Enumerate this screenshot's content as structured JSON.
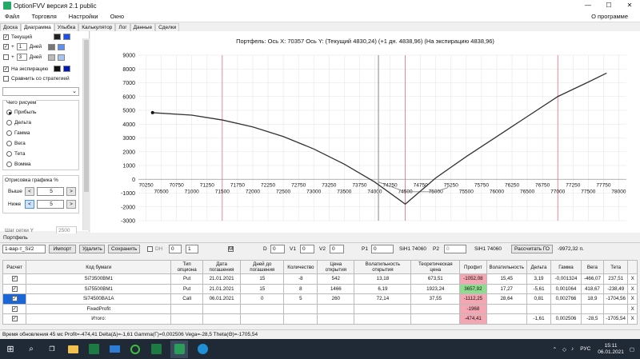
{
  "window": {
    "title": "OptionFVV версия 2.1 public",
    "minimize": "—",
    "maximize": "☐",
    "close": "✕"
  },
  "menu": {
    "file": "Файл",
    "trade": "Торговля",
    "settings": "Настройки",
    "window": "Окно",
    "about": "О программе"
  },
  "tabs": [
    "Доска",
    "Диаграмма",
    "Улыбка",
    "Калькулятор",
    "Лог",
    "Данные",
    "Сделки"
  ],
  "left": {
    "current": "Текущий",
    "plus1": "+",
    "days1_val": "1",
    "days_label": "Дней",
    "plus2": "+",
    "days2_val": "3",
    "on_expiry": "На экспирацию",
    "compare": "Сравнить со стратегией",
    "what_draw": "Чего рисуем",
    "radios": [
      "Прибыль",
      "Дельта",
      "Гамма",
      "Вега",
      "Тета",
      "Вомма"
    ],
    "scale_title": "Отрисовка графика %",
    "higher": "Выше",
    "higher_val": "5",
    "lower": "Ниже",
    "lower_val": "5",
    "step": "Шаг сетки Y",
    "step_val": "2500",
    "arrow_left": "<",
    "arrow_right": ">"
  },
  "colors": {
    "line": "#333333",
    "red": "#e05a6a",
    "grid": "#e6e6e6",
    "accent": "#1a66d6"
  },
  "chart_data": {
    "type": "line",
    "title": "Портфель:  Ось X: 70357 Ось Y:   (Текущий 4830,24)  (+1 дн. 4838,96)  (На экспирацию 4838,96)",
    "x_ticks_top": [
      "70250",
      "70750",
      "71250",
      "71750",
      "72250",
      "72750",
      "73250",
      "73750",
      "74250",
      "74750",
      "75250",
      "75750",
      "76250",
      "76750",
      "77250",
      "77750"
    ],
    "x_ticks_bottom": [
      "70500",
      "71000",
      "71500",
      "72000",
      "72500",
      "73000",
      "73500",
      "74000",
      "74500",
      "75000",
      "75500",
      "76000",
      "76500",
      "77000",
      "77500",
      "78000"
    ],
    "xlim": [
      70125,
      78125
    ],
    "ylim": [
      -3000,
      9000
    ],
    "y_ticks": [
      "9000",
      "8000",
      "7000",
      "6000",
      "5000",
      "4000",
      "3000",
      "2000",
      "1000",
      "0",
      "-1000",
      "-2000",
      "-3000"
    ],
    "series": [
      {
        "x": [
          70357,
          71000,
          71500,
          72000,
          72500,
          73000,
          73500,
          74000,
          74500,
          75000,
          75500,
          76000,
          76500,
          77000,
          77500,
          77800
        ],
        "y": [
          4830,
          4650,
          4300,
          3800,
          3100,
          2200,
          1100,
          -200,
          -1800,
          100,
          1650,
          3100,
          4550,
          6000,
          7050,
          7700
        ]
      }
    ],
    "series2": {
      "x": [
        74060,
        74500,
        75000,
        75200
      ],
      "y": [
        -200,
        -900,
        -900,
        -600
      ]
    },
    "red_lines": [
      71500,
      74500,
      77000
    ],
    "cursor_x": 74060
  },
  "portfolio": {
    "label": "Портфель",
    "select": "1-вар-т_Si/2",
    "import": "Импорт",
    "delete": "Удалить",
    "save": "Сохранить",
    "dh": "DH",
    "dh_val1": "0",
    "dh_val2": "1",
    "m": "M",
    "d_label": "D",
    "d_val": "0",
    "v1_label": "V1",
    "v1_val": "0",
    "v2_label": "V2",
    "v2_val": "0",
    "p1_label": "P1",
    "p1_val": "0",
    "p1_ticker": "SiH1 74060",
    "p2_label": "P2",
    "p2_val": "0",
    "p2_ticker": "SiH1 74060",
    "calc_btn": "Рассчитать ГО",
    "go_value": "-9972,32 п."
  },
  "table": {
    "headers": [
      "Расчет",
      "Код бумаги",
      "Тип опциона",
      "Дата погашения",
      "Дней до погашения",
      "Количество",
      "Цена открытия",
      "Волатильность открытия",
      "Теоретическая цена",
      "Профит",
      "Волатильность",
      "Дельта",
      "Гамма",
      "Вега",
      "Тета",
      ""
    ],
    "rows": [
      {
        "code": "Si73500BM1",
        "type": "Put",
        "date": "21.01.2021",
        "days": "15",
        "qty": "-8",
        "price": "542",
        "vol_open": "13,18",
        "theo": "673,51",
        "profit": "-1052,08",
        "vol": "15,45",
        "delta": "3,19",
        "gamma": "-0,001324",
        "vega": "-466,07",
        "theta": "237,51",
        "x": "X"
      },
      {
        "code": "Si75500BM1",
        "type": "Put",
        "date": "21.01.2021",
        "days": "15",
        "qty": "8",
        "price": "1466",
        "vol_open": "6,19",
        "theo": "1923,24",
        "profit": "3657,92",
        "vol": "17,27",
        "delta": "-5,61",
        "gamma": "0,001064",
        "vega": "418,67",
        "theta": "-238,49",
        "x": "X"
      },
      {
        "code": "Si74500BA1A",
        "type": "Call",
        "date": "06.01.2021",
        "days": "0",
        "qty": "5",
        "price": "260",
        "vol_open": "72,14",
        "theo": "37,55",
        "profit": "-1112,25",
        "vol": "28,64",
        "delta": "0,81",
        "gamma": "0,002766",
        "vega": "18,9",
        "theta": "-1704,56",
        "x": "X"
      },
      {
        "code": "FixedProfit",
        "type": "",
        "date": "",
        "days": "",
        "qty": "",
        "price": "",
        "vol_open": "",
        "theo": "",
        "profit": "-1968",
        "vol": "",
        "delta": "",
        "gamma": "",
        "vega": "",
        "theta": "",
        "x": "X"
      },
      {
        "code": "Итого:",
        "type": "",
        "date": "",
        "days": "",
        "qty": "",
        "price": "",
        "vol_open": "",
        "theo": "",
        "profit": "-474,41",
        "vol": "",
        "delta": "-1,61",
        "gamma": "0,002506",
        "vega": "-28,5",
        "theta": "-1705,54",
        "x": "X"
      }
    ]
  },
  "status": "Время обновления 45 мс   Profit=-474,41 Delta(Δ)=-1,61 Gamma(Γ)=0,002506 Vega=-28,5 Theta(Θ)=-1705,54",
  "taskbar": {
    "start": "⊞",
    "search": "⌕",
    "taskview": "❐",
    "lang": "РУС",
    "time": "15:11",
    "date": "06.01.2021"
  }
}
